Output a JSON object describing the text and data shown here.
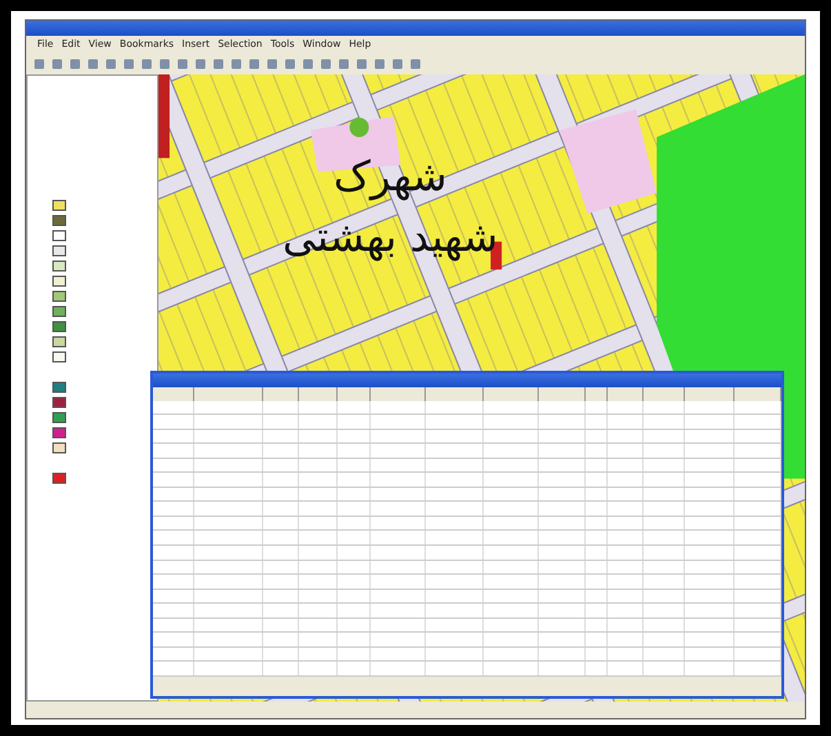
{
  "menu": [
    {
      "label": "File"
    },
    {
      "label": "Edit"
    },
    {
      "label": "View"
    },
    {
      "label": "Bookmarks"
    },
    {
      "label": "Insert"
    },
    {
      "label": "Selection"
    },
    {
      "label": "Tools"
    },
    {
      "label": "Window"
    },
    {
      "label": "Help"
    }
  ],
  "map_labels": [
    "شهرک",
    "شهید بهشتی"
  ],
  "legend_swatches": [
    {
      "color": "#f0e060"
    },
    {
      "color": "#6b6b3a"
    },
    {
      "color": "#ffffff"
    },
    {
      "color": "#e8e8e8"
    },
    {
      "color": "#d8e8c0"
    },
    {
      "color": "#f0f0d0"
    },
    {
      "color": "#a0c878"
    },
    {
      "color": "#70b060"
    },
    {
      "color": "#409040"
    },
    {
      "color": "#c8d8a0"
    },
    {
      "color": "#f8f8f0"
    }
  ],
  "legend_swatches_2": [
    {
      "color": "#208080"
    },
    {
      "color": "#a02040"
    },
    {
      "color": "#30a050"
    },
    {
      "color": "#d02090"
    },
    {
      "color": "#f0e0c0"
    }
  ],
  "highlight_swatch": {
    "color": "#e02020"
  }
}
